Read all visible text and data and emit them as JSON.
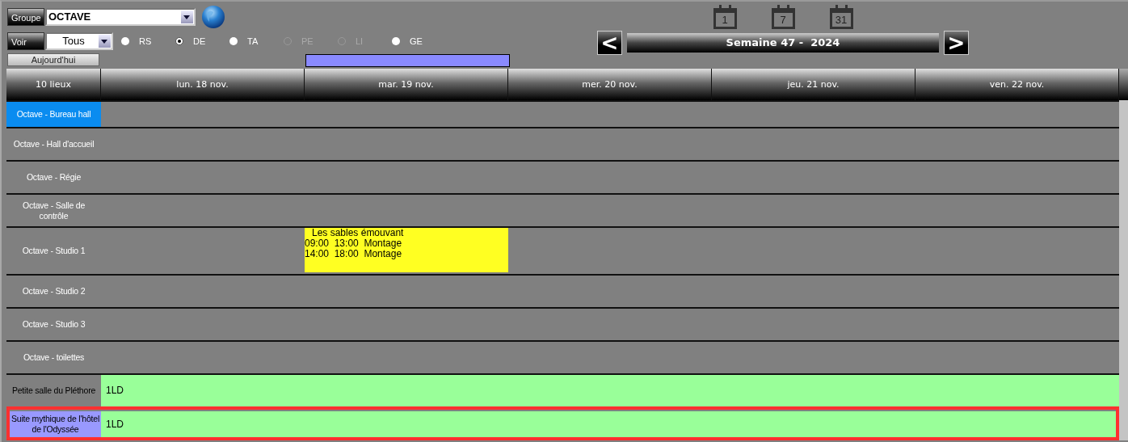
{
  "group": {
    "label": "Groupe",
    "value": "OCTAVE"
  },
  "filter": {
    "label": "Voir",
    "value": "Tous"
  },
  "types": [
    {
      "label": "RS",
      "selected": false,
      "disabled": false
    },
    {
      "label": "DE",
      "selected": true,
      "disabled": false
    },
    {
      "label": "TA",
      "selected": false,
      "disabled": false
    },
    {
      "label": "PE",
      "selected": false,
      "disabled": true
    },
    {
      "label": "LI",
      "selected": false,
      "disabled": true
    },
    {
      "label": "GE",
      "selected": false,
      "disabled": false
    }
  ],
  "today_button": "Aujourd'hui",
  "view_buttons": [
    "1",
    "7",
    "31"
  ],
  "week": {
    "prev": "<",
    "label": "Semaine 47 -  2024",
    "next": ">"
  },
  "table": {
    "corner": "10 lieux",
    "columns": [
      {
        "label": "lun. 18 nov.",
        "marked": false
      },
      {
        "label": "mar. 19 nov.",
        "marked": true
      },
      {
        "label": "mer. 20 nov.",
        "marked": false
      },
      {
        "label": "jeu. 21 nov.",
        "marked": false
      },
      {
        "label": "ven. 22 nov.",
        "marked": false
      }
    ],
    "rows": [
      {
        "label": "Octave - Bureau hall",
        "color": "#0a8cf0",
        "selected": false,
        "bookings": []
      },
      {
        "label": "Octave - Hall d'accueil",
        "color": "#808080",
        "selected": false,
        "bookings": []
      },
      {
        "label": "Octave - Régie",
        "color": "#808080",
        "selected": false,
        "bookings": []
      },
      {
        "label": "Octave - Salle de contrôle",
        "color": "#808080",
        "selected": false,
        "bookings": []
      },
      {
        "label": "Octave - Studio 1",
        "color": "#808080",
        "selected": false,
        "bookings": [
          {
            "title": "Les sables émouvant",
            "lines": [
              "09:00  13:00  Montage",
              "14:00  18:00  Montage"
            ],
            "kind": "event",
            "days": [
              false,
              true,
              false,
              false,
              false
            ]
          }
        ]
      },
      {
        "label": "Octave - Studio 2",
        "color": "#808080",
        "selected": false,
        "bookings": []
      },
      {
        "label": "Octave - Studio 3",
        "color": "#808080",
        "selected": false,
        "bookings": []
      },
      {
        "label": "Octave - toilettes",
        "color": "#808080",
        "selected": false,
        "bookings": []
      },
      {
        "label": "Petite salle du Pléthore",
        "color": "#808080",
        "selected": false,
        "bookings": [
          {
            "title": "1LD",
            "kind": "block",
            "days": [
              true,
              true,
              true,
              true,
              true
            ]
          }
        ]
      },
      {
        "label": "Suite mythique de l'hôtel de l'Odyssée",
        "color": "#9999ff",
        "selected": true,
        "bookings": [
          {
            "title": "1LD",
            "kind": "block",
            "days": [
              true,
              true,
              true,
              true,
              true
            ]
          }
        ]
      }
    ]
  }
}
